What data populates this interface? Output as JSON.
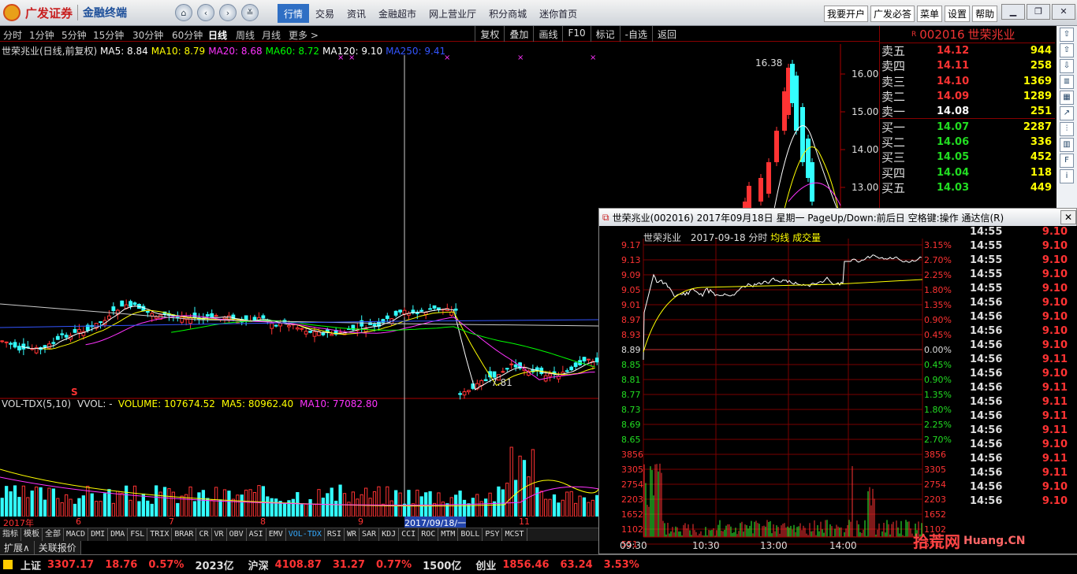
{
  "app": {
    "brand": "广发证券",
    "product": "金融终端"
  },
  "menu": [
    "行情",
    "交易",
    "资讯",
    "金融超市",
    "网上营业厅",
    "积分商城",
    "迷你首页"
  ],
  "menu_active": 0,
  "right_buttons": [
    "我要开户",
    "广发必答",
    "菜单",
    "设置",
    "帮助"
  ],
  "periods": [
    "分时",
    "1分钟",
    "5分钟",
    "15分钟",
    "30分钟",
    "60分钟",
    "日线",
    "周线",
    "月线",
    "更多 >"
  ],
  "period_active": 6,
  "tools": [
    "复权",
    "叠加",
    "画线",
    "F10",
    "标记",
    "-自选",
    "返回"
  ],
  "main_header": {
    "title": "世荣兆业(日线,前复权)",
    "ma": [
      {
        "t": "MA5: 8.84",
        "c": "#ffffff"
      },
      {
        "t": "MA10: 8.79",
        "c": "#ffff00"
      },
      {
        "t": "MA20: 8.68",
        "c": "#ff33ff"
      },
      {
        "t": "MA60: 8.72",
        "c": "#00ff00"
      },
      {
        "t": "MA120: 9.10",
        "c": "#ffffff"
      },
      {
        "t": "MA250: 9.41",
        "c": "#3355ff"
      }
    ]
  },
  "price_axis": [
    "16.00",
    "15.00",
    "14.00",
    "13.00"
  ],
  "high_label": "16.38",
  "low_label": "7.81",
  "s_marker": "S",
  "vol_header": [
    {
      "t": "VOL-TDX(5,10)",
      "c": "#dddddd"
    },
    {
      "t": "VVOL: -",
      "c": "#dddddd"
    },
    {
      "t": "VOLUME: 107674.52",
      "c": "#ffff00"
    },
    {
      "t": "MA5: 80962.40",
      "c": "#ffff00"
    },
    {
      "t": "MA10: 77082.80",
      "c": "#ff33ff"
    }
  ],
  "x_axis": [
    "2017年",
    "6",
    "7",
    "8",
    "9",
    "2017/09/18/一",
    "11"
  ],
  "indicator_tabs": [
    "指标",
    "模板",
    "全部",
    "MACD",
    "DMI",
    "DMA",
    "FSL",
    "TRIX",
    "BRAR",
    "CR",
    "VR",
    "OBV",
    "ASI",
    "EMV",
    "VOL-TDX",
    "RSI",
    "WR",
    "SAR",
    "KDJ",
    "CCI",
    "ROC",
    "MTM",
    "BOLL",
    "PSY",
    "MCST"
  ],
  "indicator_active": "VOL-TDX",
  "bottom_tabs": [
    "扩展∧",
    "关联报价"
  ],
  "orderbook": {
    "code": "002016",
    "name": "世荣兆业",
    "rows": [
      {
        "label": "卖五",
        "price": "14.12",
        "vol": "944",
        "c": "r"
      },
      {
        "label": "卖四",
        "price": "14.11",
        "vol": "258",
        "c": "r"
      },
      {
        "label": "卖三",
        "price": "14.10",
        "vol": "1369",
        "c": "r"
      },
      {
        "label": "卖二",
        "price": "14.09",
        "vol": "1289",
        "c": "r"
      },
      {
        "label": "卖一",
        "price": "14.08",
        "vol": "251",
        "c": "w"
      },
      {
        "label": "买一",
        "price": "14.07",
        "vol": "2287",
        "c": "g"
      },
      {
        "label": "买二",
        "price": "14.06",
        "vol": "336",
        "c": "g"
      },
      {
        "label": "买三",
        "price": "14.05",
        "vol": "452",
        "c": "g"
      },
      {
        "label": "买四",
        "price": "14.04",
        "vol": "118",
        "c": "g"
      },
      {
        "label": "买五",
        "price": "14.03",
        "vol": "449",
        "c": "g"
      }
    ]
  },
  "popup": {
    "title": "世荣兆业(002016) 2017年09月18日 星期一 PageUp/Down:前后日 空格键:操作 通达信(R)",
    "sub_name": "世荣兆业",
    "sub_date": "2017-09-18 分时",
    "sub_avg": "均线",
    "sub_vol": "成交量",
    "left_axis": [
      "9.17",
      "9.13",
      "9.09",
      "9.05",
      "9.01",
      "8.97",
      "8.93",
      "8.89",
      "8.85",
      "8.81",
      "8.77",
      "8.73",
      "8.69",
      "8.65"
    ],
    "right_axis": [
      "3.15%",
      "2.70%",
      "2.25%",
      "1.80%",
      "1.35%",
      "0.90%",
      "0.45%",
      "0.00%",
      "0.45%",
      "0.90%",
      "1.35%",
      "1.80%",
      "2.25%",
      "2.70%"
    ],
    "vol_axis": [
      "3856",
      "3305",
      "2754",
      "2203",
      "1652",
      "1102",
      "551"
    ],
    "time_axis": [
      "09:30",
      "10:30",
      "13:00",
      "14:00"
    ],
    "ticks": [
      {
        "t": "14:55",
        "p": "9.10"
      },
      {
        "t": "14:55",
        "p": "9.10"
      },
      {
        "t": "14:55",
        "p": "9.10"
      },
      {
        "t": "14:55",
        "p": "9.10"
      },
      {
        "t": "14:55",
        "p": "9.10"
      },
      {
        "t": "14:56",
        "p": "9.10"
      },
      {
        "t": "14:56",
        "p": "9.10"
      },
      {
        "t": "14:56",
        "p": "9.10"
      },
      {
        "t": "14:56",
        "p": "9.10"
      },
      {
        "t": "14:56",
        "p": "9.11"
      },
      {
        "t": "14:56",
        "p": "9.10"
      },
      {
        "t": "14:56",
        "p": "9.11"
      },
      {
        "t": "14:56",
        "p": "9.11"
      },
      {
        "t": "14:56",
        "p": "9.11"
      },
      {
        "t": "14:56",
        "p": "9.11"
      },
      {
        "t": "14:56",
        "p": "9.10"
      },
      {
        "t": "14:56",
        "p": "9.11"
      },
      {
        "t": "14:56",
        "p": "9.11"
      },
      {
        "t": "14:56",
        "p": "9.10"
      },
      {
        "t": "14:56",
        "p": "9.10"
      }
    ]
  },
  "status": [
    {
      "label": "上证",
      "price": "3307.17",
      "chg": "18.76",
      "pct": "0.57%",
      "amt": "2023亿"
    },
    {
      "label": "沪深",
      "price": "4108.87",
      "chg": "31.27",
      "pct": "0.77%",
      "amt": "1500亿"
    },
    {
      "label": "创业",
      "price": "1856.46",
      "chg": "63.24",
      "pct": "3.53%",
      "amt": ""
    }
  ],
  "watermark": "拾荒网",
  "watermark_url": "Huang.CN"
}
